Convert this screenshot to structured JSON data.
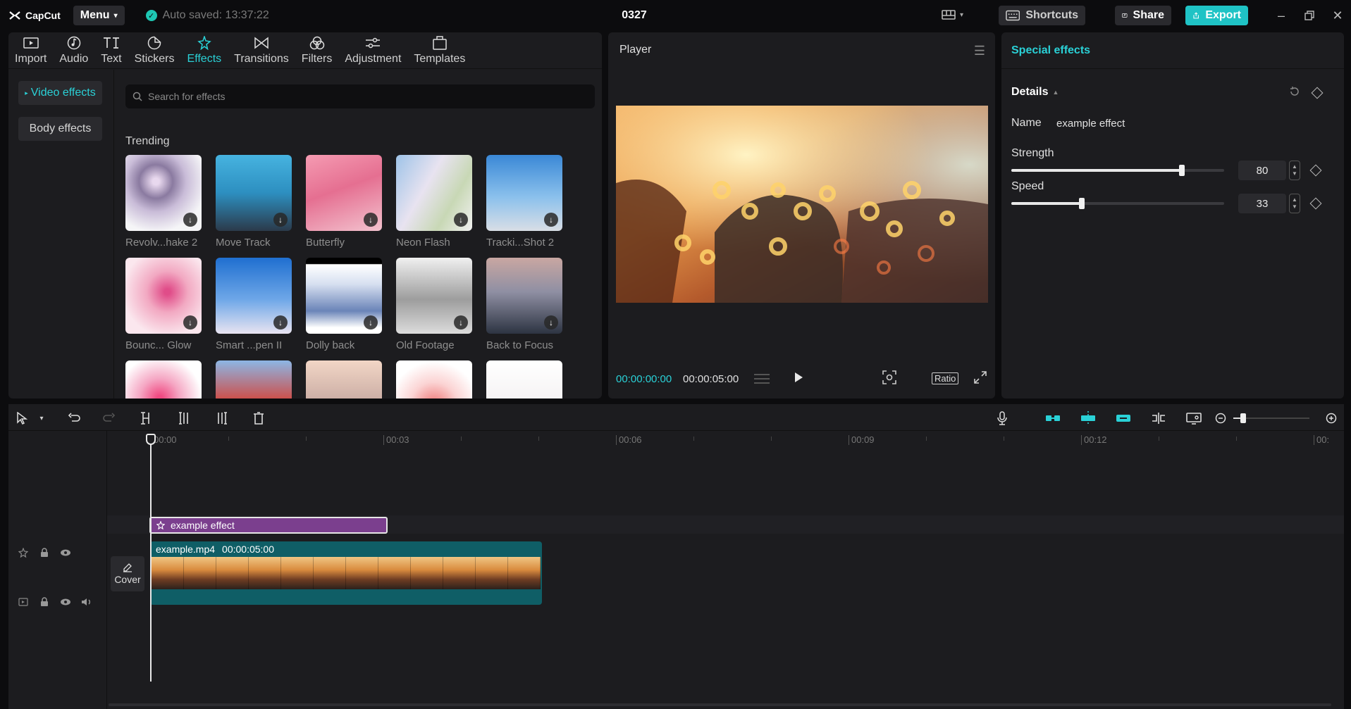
{
  "app": {
    "brand": "CapCut",
    "menu_label": "Menu",
    "autosave": "Auto saved: 13:37:22",
    "project_title": "0327",
    "shortcuts_label": "Shortcuts",
    "share_label": "Share",
    "export_label": "Export"
  },
  "media_tabs": [
    {
      "label": "Import",
      "icon": "import-icon"
    },
    {
      "label": "Audio",
      "icon": "audio-icon"
    },
    {
      "label": "Text",
      "icon": "text-icon"
    },
    {
      "label": "Stickers",
      "icon": "stickers-icon"
    },
    {
      "label": "Effects",
      "icon": "effects-icon",
      "active": true
    },
    {
      "label": "Transitions",
      "icon": "transitions-icon"
    },
    {
      "label": "Filters",
      "icon": "filters-icon"
    },
    {
      "label": "Adjustment",
      "icon": "adjustment-icon"
    },
    {
      "label": "Templates",
      "icon": "templates-icon"
    }
  ],
  "sidenav": {
    "video_effects": "Video effects",
    "body_effects": "Body effects"
  },
  "search": {
    "placeholder": "Search for effects"
  },
  "trending": {
    "title": "Trending",
    "items": [
      "Revolv...hake 2",
      "Move Track",
      "Butterfly",
      "Neon Flash",
      "Tracki...Shot 2",
      "Bounc... Glow",
      "Smart ...pen II",
      "Dolly back",
      "Old Footage",
      "Back to Focus"
    ]
  },
  "player": {
    "title": "Player",
    "current_time": "00:00:00:00",
    "total_time": "00:00:05:00",
    "ratio_label": "Ratio"
  },
  "right_panel": {
    "header": "Special effects",
    "details_label": "Details",
    "name_label": "Name",
    "name_value": "example effect",
    "strength_label": "Strength",
    "strength_value": "80",
    "speed_label": "Speed",
    "speed_value": "33",
    "strength_level": 0.8,
    "speed_level": 0.33
  },
  "timeline": {
    "ruler_labels": [
      "00:00",
      "00:03",
      "00:06",
      "00:09",
      "00:12",
      "00:"
    ],
    "effect_clip_label": "example effect",
    "video_clip_name": "example.mp4",
    "video_clip_duration": "00:00:05:00",
    "cover_label": "Cover"
  },
  "colors": {
    "accent": "#1fc3c5",
    "effect_clip": "#7b3f8e",
    "video_clip": "#0f5e66"
  }
}
